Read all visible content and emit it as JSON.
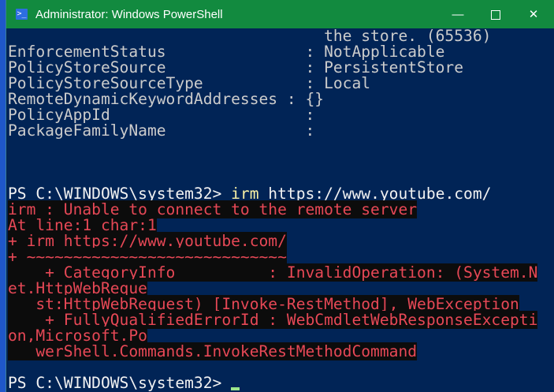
{
  "window": {
    "title": "Administrator: Windows PowerShell",
    "minimize": "—",
    "close": "✕"
  },
  "colors": {
    "background": "#012456",
    "titlebar": "#128a3f",
    "error_text": "#e74856",
    "error_bg": "#0c0c0c",
    "command": "#f9f1a5"
  },
  "output_lines": [
    "                                  the store. (65536)",
    "EnforcementStatus               : NotApplicable",
    "PolicyStoreSource               : PersistentStore",
    "PolicyStoreSourceType           : Local",
    "RemoteDynamicKeywordAddresses : {}",
    "PolicyAppId                     :",
    "PackageFamilyName               :"
  ],
  "command": {
    "prompt": "PS C:\\WINDOWS\\system32> ",
    "cmd": "irm",
    "args": " https://www.youtube.com/"
  },
  "error_lines": [
    "irm : Unable to connect to the remote server",
    "At line:1 char:1",
    "+ irm https://www.youtube.com/",
    "+ ~~~~~~~~~~~~~~~~~~~~~~~~~~~~",
    "    + CategoryInfo          : InvalidOperation: (System.N",
    "et.HttpWebReque",
    "   st:HttpWebRequest) [Invoke-RestMethod], WebException",
    "    + FullyQualifiedErrorId : WebCmdletWebResponseExcepti",
    "on,Microsoft.Po",
    "   werShell.Commands.InvokeRestMethodCommand"
  ],
  "final_prompt": "PS C:\\WINDOWS\\system32> "
}
